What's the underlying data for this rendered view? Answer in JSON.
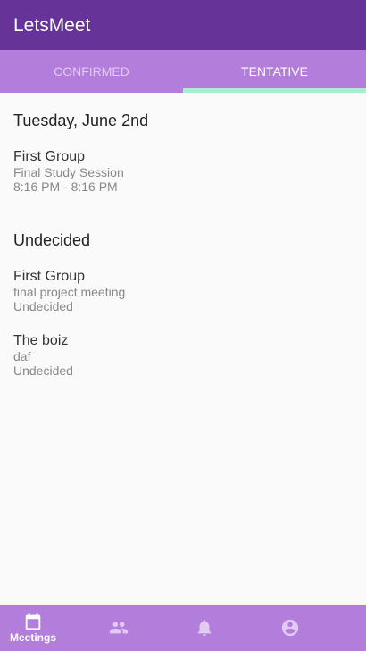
{
  "app": {
    "title": "LetsMeet"
  },
  "tabs": [
    {
      "label": "Confirmed"
    },
    {
      "label": "Tentative"
    }
  ],
  "sections": [
    {
      "title": "Tuesday, June 2nd",
      "items": [
        {
          "group": "First Group",
          "name": "Final Study Session",
          "time": "8:16 PM - 8:16 PM"
        }
      ]
    },
    {
      "title": "Undecided",
      "items": [
        {
          "group": "First Group",
          "name": "final project meeting",
          "time": "Undecided"
        },
        {
          "group": "The boiz",
          "name": "daf",
          "time": "Undecided"
        }
      ]
    }
  ],
  "nav": {
    "meetings": "Meetings"
  }
}
